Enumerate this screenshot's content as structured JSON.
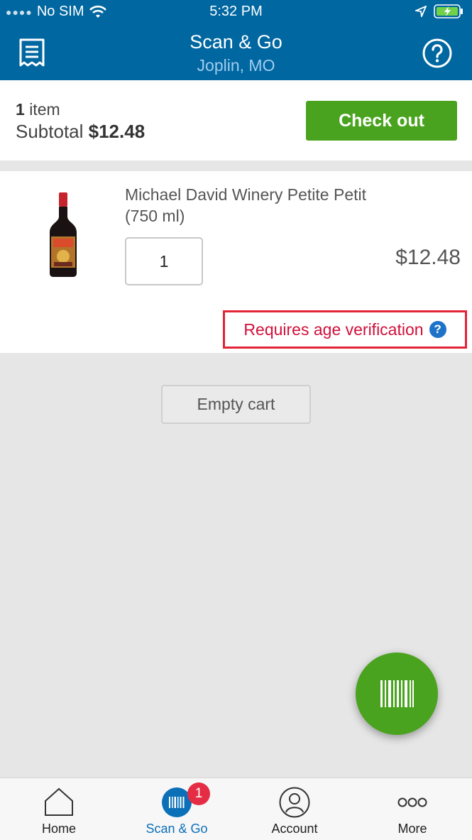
{
  "status_bar": {
    "carrier": "No SIM",
    "time": "5:32 PM"
  },
  "header": {
    "title": "Scan & Go",
    "location": "Joplin, MO"
  },
  "summary": {
    "item_count": "1",
    "item_label": "item",
    "subtotal_label": "Subtotal",
    "subtotal_value": "$12.48",
    "checkout_label": "Check out"
  },
  "cart": {
    "items": [
      {
        "name_line1": "Michael David Winery Petite Petit",
        "name_line2": "(750 ml)",
        "quantity": "1",
        "price": "$12.48",
        "age_notice": "Requires age verification"
      }
    ]
  },
  "actions": {
    "empty_cart_label": "Empty cart"
  },
  "tabs": [
    {
      "label": "Home",
      "icon": "home-icon"
    },
    {
      "label": "Scan & Go",
      "icon": "barcode-icon",
      "badge": "1",
      "active": true
    },
    {
      "label": "Account",
      "icon": "account-icon"
    },
    {
      "label": "More",
      "icon": "more-icon"
    }
  ],
  "colors": {
    "header_bg": "#0067a0",
    "checkout_green": "#4aa31f",
    "alert_red": "#d0103a",
    "active_tab_blue": "#0b70b8",
    "badge_red": "#e42c44"
  }
}
